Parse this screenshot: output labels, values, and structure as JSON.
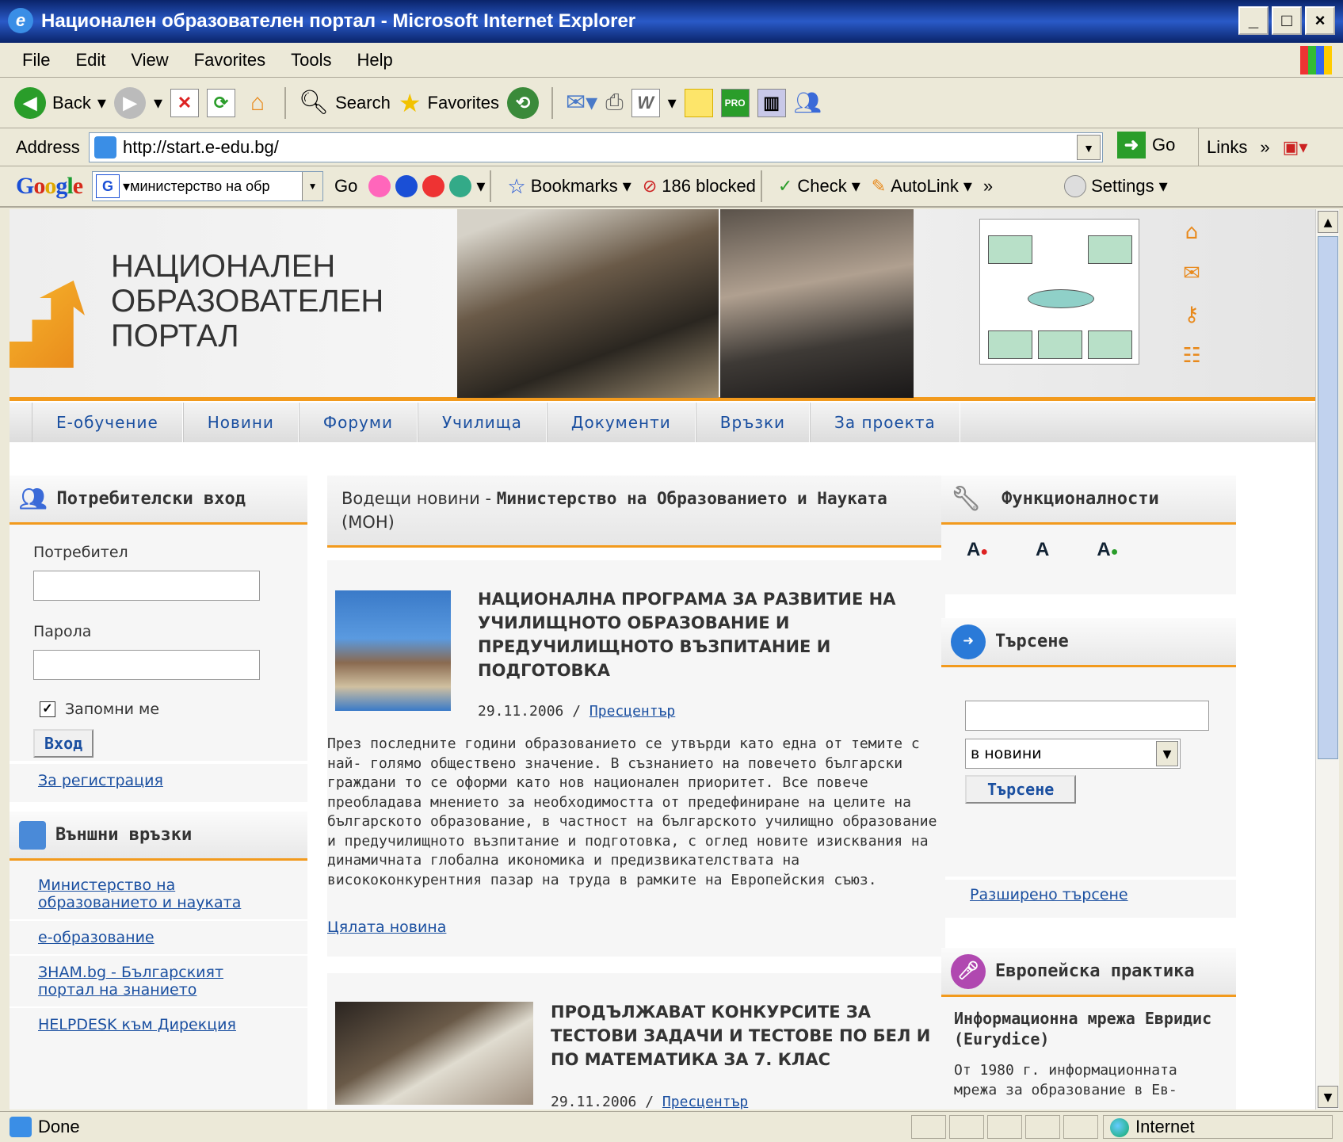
{
  "window": {
    "title": "Национален образователен портал - Microsoft Internet Explorer"
  },
  "menu": [
    "File",
    "Edit",
    "View",
    "Favorites",
    "Tools",
    "Help"
  ],
  "toolbar": {
    "back": "Back",
    "search": "Search",
    "favorites": "Favorites"
  },
  "address": {
    "label": "Address",
    "url": "http://start.e-edu.bg/",
    "go": "Go",
    "links": "Links"
  },
  "google_bar": {
    "query": "министерство на обр",
    "go": "Go",
    "bookmarks": "Bookmarks",
    "blocked": "186 blocked",
    "check": "Check",
    "autolink": "AutoLink",
    "settings": "Settings"
  },
  "status": {
    "text": "Done",
    "zone": "Internet"
  },
  "site": {
    "title_lines": [
      "НАЦИОНАЛЕН",
      "ОБРАЗОВАТЕЛЕН",
      "ПОРТАЛ"
    ],
    "nav": [
      "Е-обучение",
      "Новини",
      "Форуми",
      "Училища",
      "Документи",
      "Връзки",
      "За проекта"
    ],
    "login": {
      "heading": "Потребителски вход",
      "user_label": "Потребител",
      "password_label": "Парола",
      "remember": "Запомни ме",
      "submit": "Вход",
      "register": "За регистрация"
    },
    "external": {
      "heading": "Външни връзки",
      "links": [
        "Министерство на образованието и науката",
        "е-образование",
        "ЗНАМ.bg - Българският портал на знанието",
        "HELPDESK към Дирекция"
      ]
    },
    "news": {
      "heading_prefix": "Водещи новини - ",
      "heading_bold": "Министерство на Образованието и Науката",
      "heading_suffix": "(МОН)",
      "items": [
        {
          "title": "НАЦИОНАЛНА ПРОГРАМА ЗА РАЗВИТИЕ НА УЧИЛИЩНОТО ОБРАЗОВАНИЕ И ПРЕДУЧИЛИЩНОТО ВЪЗПИТАНИЕ И ПОДГОТОВКА",
          "date": "29.11.2006 / ",
          "category": "Пресцентър",
          "body": "През последните години образованието се утвърди като една от темите с най- голямо обществено значение. В съзнанието на повечето български граждани то се оформи като нов национален приоритет. Все повече преобладава мнението за необходимостта от предефиниране на целите на българското образование, в частност на българското училищно образование и предучилищното възпитание и подготовка, с оглед новите изисквания на динамичната глобална икономика и предизвикателствата на висококонкурентния пазар на труда в рамките на Европейския съюз.",
          "more": "Цялата новина"
        },
        {
          "title": "ПРОДЪЛЖАВАТ КОНКУРСИТЕ ЗА ТЕСТОВИ ЗАДАЧИ И ТЕСТОВЕ ПО БЕЛ И ПО МАТЕМАТИКА ЗА 7. КЛАС",
          "date": "29.11.2006 / ",
          "category": "Пресцентър"
        }
      ]
    },
    "functions": {
      "heading": "Функционалности",
      "sizes": [
        "A",
        "A",
        "A"
      ]
    },
    "search": {
      "heading": "Търсене",
      "scope": "в новини",
      "submit": "Търсене",
      "advanced": "Разширено търсене"
    },
    "practice": {
      "heading": "Европейска практика",
      "item_title": "Информационна мрежа Евридис (Eurydice)",
      "item_text": "От 1980 г. информационната мрежа за образование в Ев-"
    }
  }
}
